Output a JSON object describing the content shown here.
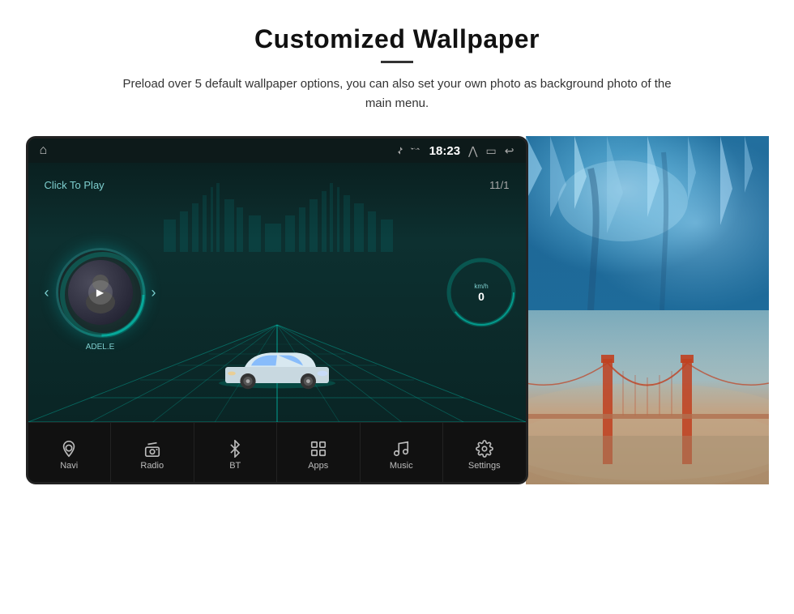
{
  "header": {
    "title": "Customized Wallpaper",
    "subtitle": "Preload over 5 default wallpaper options, you can also set your own photo as background photo of the main menu."
  },
  "screen": {
    "status_bar": {
      "time": "18:23",
      "bluetooth": "BT",
      "signal": "▾"
    },
    "main": {
      "click_to_play": "Click To Play",
      "date": "11/1",
      "artist": "ADEL.E"
    },
    "nav_items": [
      {
        "id": "navi",
        "label": "Navi",
        "icon": "location"
      },
      {
        "id": "radio",
        "label": "Radio",
        "icon": "radio"
      },
      {
        "id": "bt",
        "label": "BT",
        "icon": "bluetooth"
      },
      {
        "id": "apps",
        "label": "Apps",
        "icon": "apps"
      },
      {
        "id": "music",
        "label": "Music",
        "icon": "music"
      },
      {
        "id": "settings",
        "label": "Settings",
        "icon": "settings"
      }
    ]
  },
  "wallpapers": [
    {
      "id": "ice",
      "label": "Ice Cave"
    },
    {
      "id": "bridge",
      "label": "Golden Gate Bridge"
    }
  ],
  "colors": {
    "accent": "#0dd0c0",
    "screen_bg": "#0d1a1a",
    "nav_bg": "#111111"
  }
}
